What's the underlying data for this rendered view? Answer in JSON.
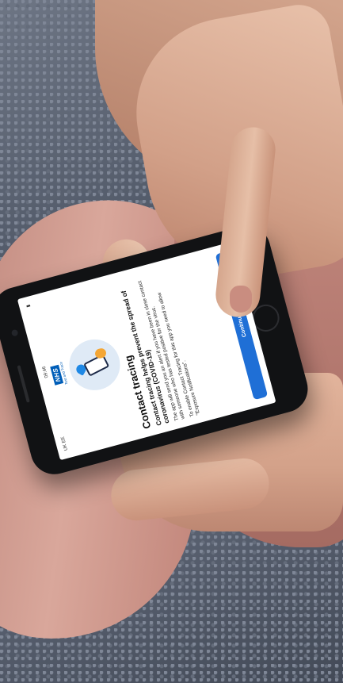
{
  "status_bar": {
    "carrier": "UK EE",
    "time": "09:46"
  },
  "header": {
    "logo_text": "NHS",
    "logo_subtitle": "Test and Trace"
  },
  "illustration": {
    "icon": "phone-shield-icon"
  },
  "content": {
    "title": "Contact tracing",
    "subtitle": "Contact tracing helps prevent the spread of coronavirus (COVID-19)",
    "paragraph_1": "The app will send you an alert if you have been in close contact with someone who has tested positive for the virus.",
    "paragraph_2": "To enable Contact Tracing for this app you need to allow \"Exposure Notifications\"."
  },
  "actions": {
    "continue_label": "Continue"
  },
  "colors": {
    "nhs_blue": "#005eb8",
    "button_blue": "#1f6fd6"
  }
}
